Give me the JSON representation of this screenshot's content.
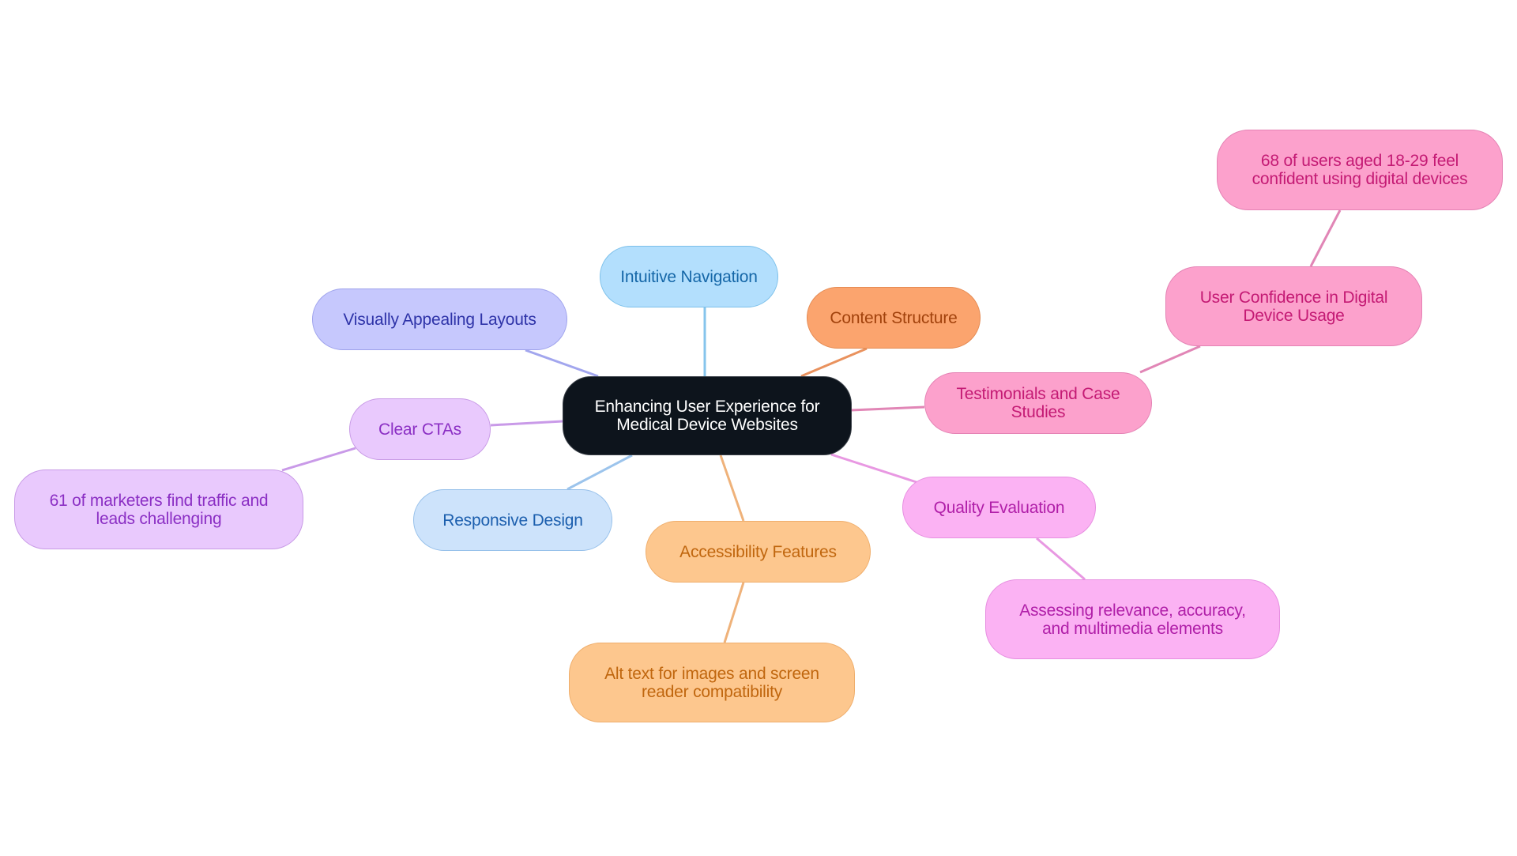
{
  "diagram": {
    "type": "mindmap",
    "root": {
      "id": "root",
      "label": "Enhancing User Experience for Medical Device Websites",
      "fill": "#0d141c",
      "border": "#3a4048",
      "text": "#ffffff"
    },
    "nodes": [
      {
        "id": "intuitive-navigation",
        "label": "Intuitive Navigation",
        "parent": "root",
        "fill": "#b3dffd",
        "border": "#7cc0ea",
        "text": "#1567a8",
        "edge": "#86c4ec"
      },
      {
        "id": "content-structure",
        "label": "Content Structure",
        "parent": "root",
        "fill": "#fba46e",
        "border": "#e48a52",
        "text": "#a2420c",
        "edge": "#e9925e"
      },
      {
        "id": "visually-appealing-layouts",
        "label": "Visually Appealing Layouts",
        "parent": "root",
        "fill": "#c6c8fd",
        "border": "#9ea2ec",
        "text": "#2e33a8",
        "edge": "#a2a6ee"
      },
      {
        "id": "clear-ctas",
        "label": "Clear CTAs",
        "parent": "root",
        "fill": "#e9c9fd",
        "border": "#c89ae6",
        "text": "#8b2fc4",
        "edge": "#c99ae8"
      },
      {
        "id": "marketers-stat",
        "label": "61 of marketers find traffic and leads challenging",
        "parent": "clear-ctas",
        "fill": "#e9c9fd",
        "border": "#c89ae6",
        "text": "#8b2fc4",
        "edge": "#c99ae8"
      },
      {
        "id": "responsive-design",
        "label": "Responsive Design",
        "parent": "root",
        "fill": "#cde3fb",
        "border": "#96c0ea",
        "text": "#1c5fae",
        "edge": "#9cc4ec"
      },
      {
        "id": "accessibility-features",
        "label": "Accessibility Features",
        "parent": "root",
        "fill": "#fdc78e",
        "border": "#efae6c",
        "text": "#c0660e",
        "edge": "#efb27a"
      },
      {
        "id": "alt-text",
        "label": "Alt text for images and screen reader compatibility",
        "parent": "accessibility-features",
        "fill": "#fdc78e",
        "border": "#efae6c",
        "text": "#c0660e",
        "edge": "#efb27a"
      },
      {
        "id": "quality-evaluation",
        "label": "Quality Evaluation",
        "parent": "root",
        "fill": "#fbb2f3",
        "border": "#e68ee0",
        "text": "#b01fa8",
        "edge": "#e898e2"
      },
      {
        "id": "assessing",
        "label": "Assessing relevance, accuracy, and multimedia elements",
        "parent": "quality-evaluation",
        "fill": "#fbb2f3",
        "border": "#e68ee0",
        "text": "#b01fa8",
        "edge": "#e898e2"
      },
      {
        "id": "testimonials",
        "label": "Testimonials and Case Studies",
        "parent": "root",
        "fill": "#fca1cc",
        "border": "#e482b4",
        "text": "#c41a74",
        "edge": "#e186b6"
      },
      {
        "id": "user-confidence",
        "label": "User Confidence in Digital Device Usage",
        "parent": "testimonials",
        "fill": "#fca1cc",
        "border": "#e482b4",
        "text": "#c41a74",
        "edge": "#e186b6"
      },
      {
        "id": "users-stat",
        "label": "68 of users aged 18-29 feel confident using digital devices",
        "parent": "user-confidence",
        "fill": "#fca1cc",
        "border": "#e482b4",
        "text": "#c41a74",
        "edge": "#e186b6"
      }
    ]
  }
}
